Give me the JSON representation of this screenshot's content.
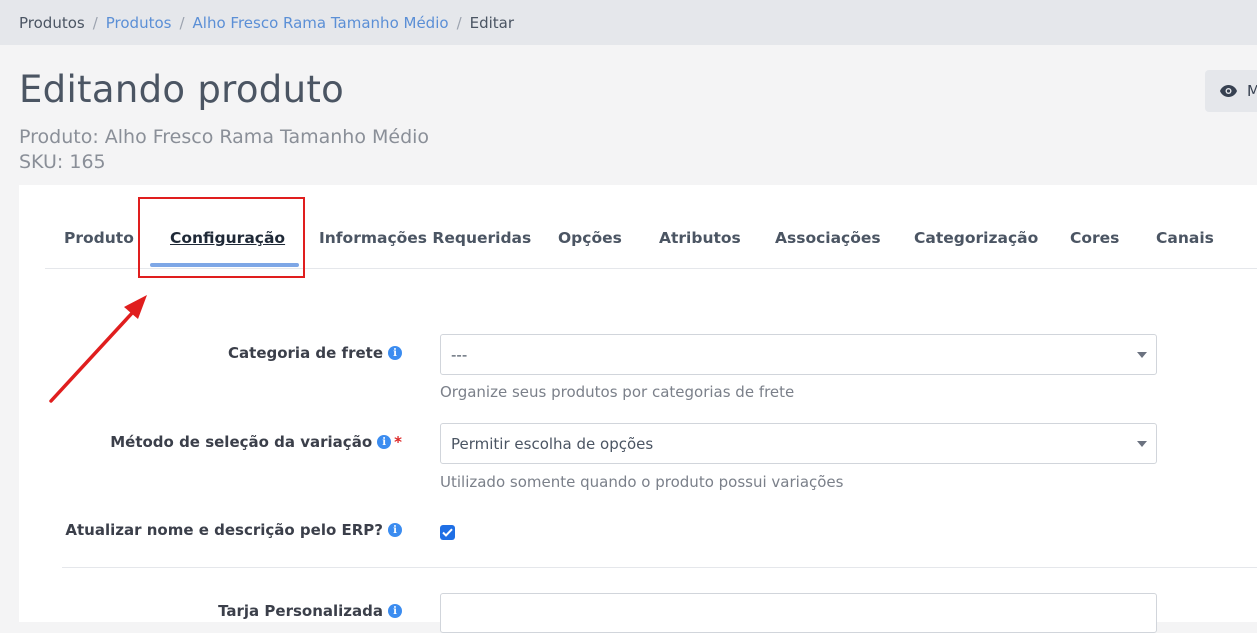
{
  "breadcrumb": {
    "items": [
      {
        "label": "Produtos",
        "link": false
      },
      {
        "label": "Produtos",
        "link": true
      },
      {
        "label": "Alho Fresco Rama Tamanho Médio",
        "link": true
      },
      {
        "label": "Editar",
        "link": false
      }
    ],
    "separator": "/"
  },
  "header": {
    "title": "Editando produto",
    "product_line": "Produto: Alho Fresco Rama Tamanho Médio",
    "sku_line": "SKU: 165",
    "view_button_label": "M"
  },
  "tabs": [
    {
      "label": "Produto",
      "active": false
    },
    {
      "label": "Configuração",
      "active": true
    },
    {
      "label": "Informações Requeridas",
      "active": false
    },
    {
      "label": "Opções",
      "active": false
    },
    {
      "label": "Atributos",
      "active": false
    },
    {
      "label": "Associações",
      "active": false
    },
    {
      "label": "Categorização",
      "active": false
    },
    {
      "label": "Cores",
      "active": false
    },
    {
      "label": "Canais",
      "active": false
    }
  ],
  "form": {
    "shipping_category": {
      "label": "Categoria de frete",
      "value": "---",
      "help": "Organize seus produtos por categorias de frete"
    },
    "variation_method": {
      "label": "Método de seleção da variação",
      "required_mark": "*",
      "value": "Permitir escolha de opções",
      "help": "Utilizado somente quando o produto possui variações"
    },
    "erp_update": {
      "label": "Atualizar nome e descrição pelo ERP?",
      "checked": true
    },
    "custom_stripe": {
      "label": "Tarja Personalizada",
      "value": ""
    }
  },
  "icons": {
    "info": "i"
  },
  "colors": {
    "accent": "#3b8cf0",
    "tab_underline": "#7ea7e6",
    "annotation_red": "#e01e1e",
    "link": "#5b8fd6"
  }
}
